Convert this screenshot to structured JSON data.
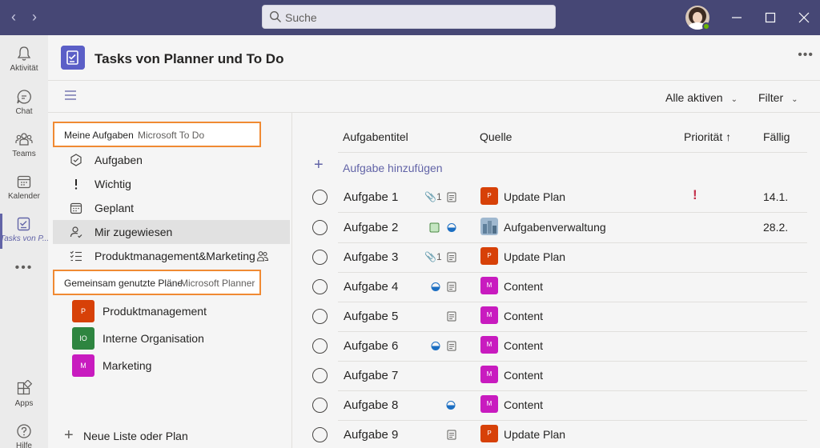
{
  "titlebar": {
    "search_placeholder": "Suche",
    "back_label": "<",
    "forward_label": ">",
    "minimize": "–",
    "maximize": "□",
    "close": "✕"
  },
  "rail": {
    "items": [
      {
        "label": "Aktivität",
        "icon": "bell-icon"
      },
      {
        "label": "Chat",
        "icon": "chat-icon"
      },
      {
        "label": "Teams",
        "icon": "teams-icon"
      },
      {
        "label": "Kalender",
        "icon": "calendar-icon"
      },
      {
        "label": "Tasks von P...",
        "icon": "tasks-icon"
      },
      {
        "label": "Apps",
        "icon": "apps-icon"
      },
      {
        "label": "Hilfe",
        "icon": "help-icon"
      }
    ],
    "more": "•••"
  },
  "app": {
    "title": "Tasks von Planner und To Do",
    "more": "•••"
  },
  "toolbar": {
    "filter_active": "Alle aktiven",
    "filter": "Filter"
  },
  "leftnav": {
    "my_tasks": {
      "title": "Meine Aufgaben",
      "source": "Microsoft To Do"
    },
    "items": [
      {
        "label": "Aufgaben",
        "icon": "check-circle-icon"
      },
      {
        "label": "Wichtig",
        "icon": "exclamation-icon"
      },
      {
        "label": "Geplant",
        "icon": "calendar-grid-icon"
      },
      {
        "label": "Mir zugewiesen",
        "icon": "assigned-person-icon"
      },
      {
        "label": "Produktmanagement&Marketing",
        "icon": "checklist-icon"
      }
    ],
    "shared_plans": {
      "title": "Gemeinsam genutzte Pläne",
      "source": "Microsoft Planner"
    },
    "plans": [
      {
        "label": "Produktmanagement",
        "badge": "P",
        "color": "#d74108"
      },
      {
        "label": "Interne Organisation",
        "badge": "IO",
        "color": "#2e8540"
      },
      {
        "label": "Marketing",
        "badge": "M",
        "color": "#c81bbf"
      }
    ],
    "new_list": "Neue Liste oder Plan"
  },
  "tasklist": {
    "headers": {
      "title": "Aufgabentitel",
      "source": "Quelle",
      "priority": "Priorität ↑",
      "due": "Fällig"
    },
    "add_task": "Aufgabe hinzufügen",
    "rows": [
      {
        "name": "Aufgabe 1",
        "attachments": "1",
        "source": "Update Plan",
        "badge": "P",
        "color": "#d74108",
        "priority": "!",
        "due": "14.1."
      },
      {
        "name": "Aufgabe 2",
        "attachments": "",
        "source": "Aufgabenverwaltung",
        "badge": "",
        "color": "#6a8fb0",
        "priority": "",
        "due": "28.2."
      },
      {
        "name": "Aufgabe 3",
        "attachments": "1",
        "source": "Update Plan",
        "badge": "P",
        "color": "#d74108",
        "priority": "",
        "due": ""
      },
      {
        "name": "Aufgabe 4",
        "attachments": "",
        "source": "Content",
        "badge": "M",
        "color": "#c81bbf",
        "priority": "",
        "due": ""
      },
      {
        "name": "Aufgabe 5",
        "attachments": "",
        "source": "Content",
        "badge": "M",
        "color": "#c81bbf",
        "priority": "",
        "due": ""
      },
      {
        "name": "Aufgabe 6",
        "attachments": "",
        "source": "Content",
        "badge": "M",
        "color": "#c81bbf",
        "priority": "",
        "due": ""
      },
      {
        "name": "Aufgabe 7",
        "attachments": "",
        "source": "Content",
        "badge": "M",
        "color": "#c81bbf",
        "priority": "",
        "due": ""
      },
      {
        "name": "Aufgabe 8",
        "attachments": "",
        "source": "Content",
        "badge": "M",
        "color": "#c81bbf",
        "priority": "",
        "due": ""
      },
      {
        "name": "Aufgabe 9",
        "attachments": "",
        "source": "Update Plan",
        "badge": "P",
        "color": "#d74108",
        "priority": "",
        "due": ""
      }
    ]
  }
}
